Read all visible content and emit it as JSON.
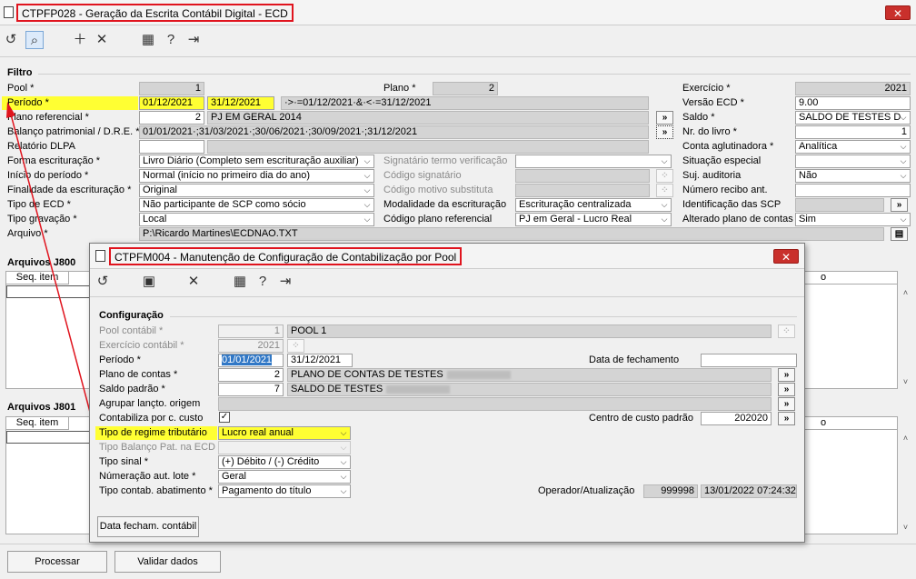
{
  "main": {
    "title": "CTPFP028 - Geração da Escrita Contábil Digital - ECD",
    "filtro_label": "Filtro",
    "col1": {
      "pool_label": "Pool *",
      "pool_value": "1",
      "periodo_label": "Período *",
      "periodo_ini": "01/12/2021",
      "periodo_fim": "31/12/2021",
      "periodo_expr": "·>·=01/12/2021·&·<·=31/12/2021",
      "plano_ref_label": "Plano referencial *",
      "plano_ref_code": "2",
      "plano_ref_desc": "PJ EM GERAL 2014",
      "balanco_label": "Balanço patrimonial / D.R.E. *",
      "balanco_value": "01/01/2021·;31/03/2021·;30/06/2021·;30/09/2021·;31/12/2021",
      "relatorio_label": "Relatório DLPA",
      "forma_label": "Forma escrituração *",
      "forma_value": "Livro Diário (Completo sem escrituração auxiliar)",
      "inicio_label": "Início do período *",
      "inicio_value": "Normal (início no primeiro dia do ano)",
      "finalidade_label": "Finalidade da escrituração *",
      "finalidade_value": "Original",
      "tipo_ecd_label": "Tipo de ECD *",
      "tipo_ecd_value": "Não participante de SCP como sócio",
      "tipo_grav_label": "Tipo gravação *",
      "tipo_grav_value": "Local",
      "arquivo_label": "Arquivo *",
      "arquivo_value": "P:\\Ricardo Martines\\ECDNAO.TXT"
    },
    "col2": {
      "plano_label": "Plano *",
      "plano_value": "2",
      "signatario_label": "Signatário termo verificação",
      "codigo_sig_label": "Código signatário",
      "codigo_motivo_label": "Código motivo substituta",
      "modalidade_label": "Modalidade da escrituração",
      "modalidade_value": "Escrituração centralizada",
      "codigo_plano_label": "Código plano referencial",
      "codigo_plano_value": "PJ em Geral - Lucro Real"
    },
    "col3": {
      "exercicio_label": "Exercício *",
      "exercicio_value": "2021",
      "versao_label": "Versão ECD *",
      "versao_value": "9.00",
      "saldo_label": "Saldo *",
      "saldo_value": "SALDO DE TESTES D",
      "nr_livro_label": "Nr. do livro *",
      "nr_livro_value": "1",
      "conta_agl_label": "Conta aglutinadora *",
      "conta_agl_value": "Analítica",
      "situacao_label": "Situação especial",
      "suj_aud_label": "Suj. auditoria",
      "suj_aud_value": "Não",
      "numero_recibo_label": "Número recibo ant.",
      "ident_scp_label": "Identificação das SCP",
      "alterado_label": "Alterado plano de contas",
      "alterado_value": "Sim"
    },
    "arquivos_j800": "Arquivos J800",
    "arquivos_j801": "Arquivos J801",
    "seq_item": "Seq. item",
    "col_o": "o",
    "processar": "Processar",
    "validar": "Validar dados"
  },
  "dialog": {
    "title": "CTPFM004 - Manutenção de Configuração de Contabilização por Pool",
    "configuracao": "Configuração",
    "pool_label": "Pool contábil *",
    "pool_code": "1",
    "pool_desc": "POOL 1",
    "exercicio_label": "Exercício contábil *",
    "exercicio_value": "2021",
    "periodo_label": "Período *",
    "periodo_ini": "01/01/2021",
    "periodo_fim": "31/12/2021",
    "data_fech_label": "Data de fechamento",
    "plano_label": "Plano de contas *",
    "plano_code": "2",
    "plano_desc": "PLANO DE CONTAS DE TESTES",
    "saldo_label": "Saldo padrão *",
    "saldo_code": "7",
    "saldo_desc": "SALDO DE TESTES",
    "agrupar_label": "Agrupar lançto. origem",
    "contabiliza_label": "Contabiliza por c. custo",
    "centro_label": "Centro de custo padrão",
    "centro_value": "202020",
    "regime_label": "Tipo de regime tributário",
    "regime_value": "Lucro real anual",
    "balanco_label": "Tipo Balanço Pat. na ECD",
    "sinal_label": "Tipo sinal *",
    "sinal_value": "(+) Débito / (-) Crédito",
    "numeracao_label": "Númeração aut. lote *",
    "numeracao_value": "Geral",
    "abatimento_label": "Tipo contab. abatimento *",
    "abatimento_value": "Pagamento do título",
    "operador_label": "Operador/Atualização",
    "operador_value": "999998",
    "atualizacao_value": "13/01/2022 07:24:32",
    "data_fech_btn": "Data fecham. contábil"
  },
  "colors": {
    "highlight": "#ffff33",
    "title_border": "#e0141e",
    "arrow": "#e0141e",
    "close": "#c9302c"
  }
}
